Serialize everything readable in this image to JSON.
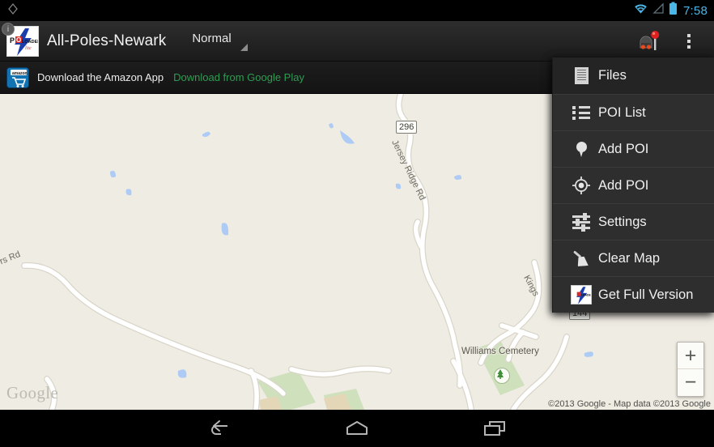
{
  "status_bar": {
    "time": "7:58",
    "icons": [
      "wifi-icon",
      "cell-signal-icon",
      "battery-icon"
    ],
    "accent_color": "#4bb6e8",
    "left_icon": "gps-idle-icon"
  },
  "action_bar": {
    "app_logo": "poi-loader-lite-logo",
    "title": "All-Poles-Newark",
    "spinner": {
      "value": "Normal",
      "options": [
        "Normal"
      ]
    },
    "radar_icon": "speed-camera-poi-icon",
    "overflow_icon": "overflow-menu-icon"
  },
  "ad_banner": {
    "icon": "amazon-app-icon",
    "text": "Download the Amazon App",
    "link": "Download from Google Play",
    "link_color": "#2e9c52",
    "info_badge": "i"
  },
  "overflow_menu": {
    "items": [
      {
        "label": "Files",
        "icon": "files-icon",
        "selected": true
      },
      {
        "label": "POI List",
        "icon": "list-icon",
        "selected": false
      },
      {
        "label": "Add POI",
        "icon": "map-pin-icon",
        "selected": false
      },
      {
        "label": "Add POI",
        "icon": "crosshair-icon",
        "selected": false
      },
      {
        "label": "Settings",
        "icon": "sliders-icon",
        "selected": false
      },
      {
        "label": "Clear Map",
        "icon": "broom-icon",
        "selected": false
      },
      {
        "label": "Get Full Version",
        "icon": "poi-loader-logo-icon",
        "selected": false
      }
    ]
  },
  "map": {
    "background_color": "#efece3",
    "watermark": "Google",
    "attribution": "©2013 Google - Map data ©2013 Google",
    "labels": [
      {
        "name": "road-label-jersey-ridge",
        "text": "Jersey Ridge Rd"
      },
      {
        "name": "road-label-kings",
        "text": "Kings"
      },
      {
        "name": "road-label-rs-rd",
        "text": "rs Rd"
      },
      {
        "name": "place-label-cemetery",
        "text": "Williams Cemetery"
      }
    ],
    "shields": [
      {
        "name": "route-shield-296",
        "text": "296"
      },
      {
        "name": "route-shield-144",
        "text": "144"
      }
    ],
    "zoom_controls": {
      "zoom_in": "+",
      "zoom_out": "−"
    },
    "poi_icon": "cemetery-tree-icon"
  },
  "nav_bar": {
    "back": "back-icon",
    "home": "home-icon",
    "recents": "recent-apps-icon"
  }
}
